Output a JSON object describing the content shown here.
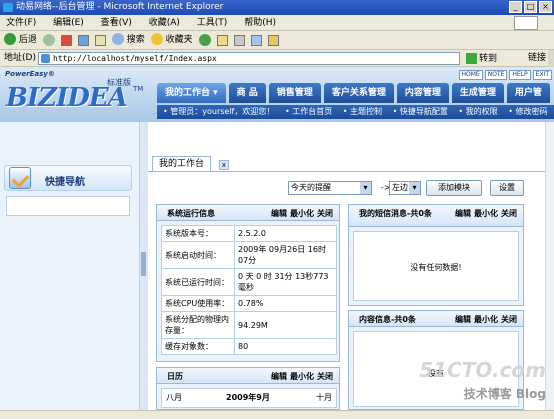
{
  "window": {
    "title": "动易网络--后台管理 - Microsoft Internet Explorer",
    "controls": [
      "_",
      "□",
      "×"
    ]
  },
  "menu": [
    "文件(F)",
    "编辑(E)",
    "查看(V)",
    "收藏(A)",
    "工具(T)",
    "帮助(H)"
  ],
  "toolbar": {
    "back": "后退",
    "search": "搜索",
    "favorites": "收藏夹"
  },
  "address": {
    "label": "地址(D)",
    "url": "http://localhost/myself/Index.aspx",
    "go": "转到",
    "links": "链接"
  },
  "header": {
    "logo_top": "PowerEasy®",
    "logo": "BIZIDEA",
    "tm": "TM",
    "edition": "标准版",
    "quick_links": [
      "HOME",
      "NOTE",
      "HELP",
      "EXIT"
    ],
    "nav_tabs": [
      "我的工作台 ▾",
      "商  品",
      "销售管理",
      "客户关系管理",
      "内容管理",
      "生成管理",
      "用户管"
    ],
    "subnav": [
      "• 管理员：yourself，欢迎您！",
      "• 工作台首页",
      "• 主题控制",
      "• 快捷导航配置",
      "• 我的权限",
      "• 修改密码"
    ]
  },
  "sidebar": {
    "title": "快捷导航"
  },
  "content": {
    "tab_label": "我的工作台",
    "tab_close": "x",
    "reminder_select": "今天的提醒",
    "arrow_text": "->",
    "position_select": "左边",
    "add_module_button": "添加模块",
    "settings_button": "设置",
    "panel_actions": [
      "编辑",
      "最小化",
      "关闭"
    ],
    "system_panel": {
      "title": "系统运行信息",
      "rows": [
        {
          "key": "系统版本号：",
          "value": "2.5.2.0"
        },
        {
          "key": "系统启动时间：",
          "value": "2009年 09月26日 16时07分"
        },
        {
          "key": "系统已运行时间：",
          "value": "0 天 0 时 31分 13秒773毫秒"
        },
        {
          "key": "系统CPU使用率：",
          "value": "0.78%"
        },
        {
          "key": "系统分配的物理内存量：",
          "value": "94.29M"
        },
        {
          "key": "缓存对象数：",
          "value": "80"
        }
      ]
    },
    "sms_panel": {
      "title": "我的短信消息-共0条",
      "empty": "没有任何数据!"
    },
    "content_panel": {
      "title": "内容信息-共0条",
      "empty": "没有"
    },
    "calendar_panel": {
      "title": "日历",
      "left": "八月",
      "center": "2009年9月",
      "right": "十月"
    }
  },
  "watermark": {
    "line1": "51CTO.com",
    "line2": "技术博客 Blog"
  }
}
